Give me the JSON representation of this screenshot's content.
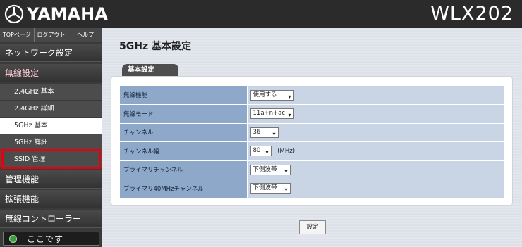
{
  "header": {
    "brand": "YAMAHA",
    "model": "WLX202"
  },
  "sidebar": {
    "top_links": [
      {
        "label": "TOPページ"
      },
      {
        "label": "ログアウト"
      },
      {
        "label": "ヘルプ"
      }
    ],
    "menu": {
      "network": "ネットワーク設定",
      "wireless": "無線設定",
      "sub_items": [
        {
          "label": "2.4GHz 基本"
        },
        {
          "label": "2.4GHz 詳細"
        },
        {
          "label": "5GHz 基本"
        },
        {
          "label": "5GHz 詳細"
        },
        {
          "label": "SSID 管理"
        }
      ],
      "management": "管理機能",
      "extension": "拡張機能",
      "controller": "無線コントローラー"
    },
    "you_are_here": "ここです"
  },
  "main": {
    "title": "5GHz 基本設定",
    "section_tab": "基本設定",
    "rows": [
      {
        "label": "無線機能",
        "value": "使用する",
        "unit": ""
      },
      {
        "label": "無線モード",
        "value": "11a+n+ac",
        "unit": ""
      },
      {
        "label": "チャンネル",
        "value": "36",
        "unit": ""
      },
      {
        "label": "チャンネル幅",
        "value": "80",
        "unit": "(MHz)"
      },
      {
        "label": "プライマリチャンネル",
        "value": "下側波帯",
        "unit": ""
      },
      {
        "label": "プライマリ40MHzチャンネル",
        "value": "下側波帯",
        "unit": ""
      }
    ],
    "submit_label": "設定"
  },
  "colors": {
    "header_bg": "#2b2b2b",
    "sidebar_bg": "#3a3a3a",
    "label_cell": "#8da8c8",
    "value_cell": "#c9d5e5",
    "highlight": "#e8000d"
  }
}
